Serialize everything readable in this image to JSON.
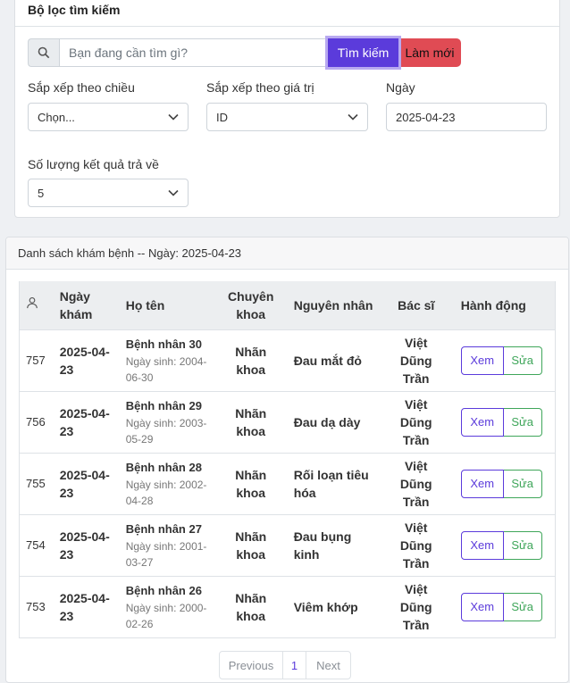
{
  "filter": {
    "title": "Bộ lọc tìm kiếm",
    "search_placeholder": "Bạn đang cần tìm gì?",
    "search_button": "Tìm kiếm",
    "reset_button": "Làm mới",
    "sort_direction_label": "Sắp xếp theo chiều",
    "sort_direction_value": "Chọn...",
    "sort_value_label": "Sắp xếp theo giá trị",
    "sort_value_value": "ID",
    "date_label": "Ngày",
    "date_value": "2025-04-23",
    "result_count_label": "Số lượng kết quả trả về",
    "result_count_value": "5"
  },
  "list": {
    "header": "Danh sách khám bệnh -- Ngày: 2025-04-23",
    "columns": {
      "date": "Ngày khám",
      "name": "Họ tên",
      "dept": "Chuyên khoa",
      "reason": "Nguyên nhân",
      "doctor": "Bác sĩ",
      "actions": "Hành động"
    },
    "rows": [
      {
        "id": "757",
        "date": "2025-04-23",
        "name": "Bệnh nhân 30",
        "dob": "Ngày sinh: 2004-06-30",
        "dept": "Nhãn khoa",
        "reason": "Đau mắt đỏ",
        "doctor": "Việt Dũng Trần",
        "view": "Xem",
        "edit": "Sửa"
      },
      {
        "id": "756",
        "date": "2025-04-23",
        "name": "Bệnh nhân 29",
        "dob": "Ngày sinh: 2003-05-29",
        "dept": "Nhãn khoa",
        "reason": "Đau dạ dày",
        "doctor": "Việt Dũng Trần",
        "view": "Xem",
        "edit": "Sửa"
      },
      {
        "id": "755",
        "date": "2025-04-23",
        "name": "Bệnh nhân 28",
        "dob": "Ngày sinh: 2002-04-28",
        "dept": "Nhãn khoa",
        "reason": "Rối loạn tiêu hóa",
        "doctor": "Việt Dũng Trần",
        "view": "Xem",
        "edit": "Sửa"
      },
      {
        "id": "754",
        "date": "2025-04-23",
        "name": "Bệnh nhân 27",
        "dob": "Ngày sinh: 2001-03-27",
        "dept": "Nhãn khoa",
        "reason": "Đau bụng kinh",
        "doctor": "Việt Dũng Trần",
        "view": "Xem",
        "edit": "Sửa"
      },
      {
        "id": "753",
        "date": "2025-04-23",
        "name": "Bệnh nhân 26",
        "dob": "Ngày sinh: 2000-02-26",
        "dept": "Nhãn khoa",
        "reason": "Viêm khớp",
        "doctor": "Việt Dũng Trần",
        "view": "Xem",
        "edit": "Sửa"
      }
    ]
  },
  "pagination": {
    "prev": "Previous",
    "current": "1",
    "next": "Next"
  },
  "colors": {
    "primary": "#5b3bdb",
    "danger": "#e04b54",
    "success": "#3fa65a"
  },
  "icons": {
    "search_addon": "search-icon",
    "id_column": "user-icon",
    "select_caret": "chevron-down-icon"
  }
}
